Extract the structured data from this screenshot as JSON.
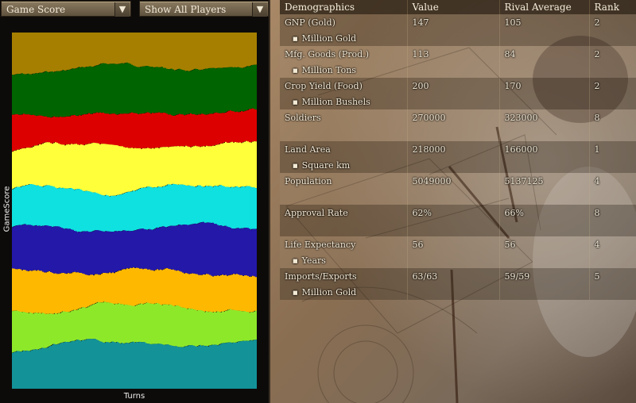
{
  "controls": {
    "score_dropdown": "Game Score",
    "players_dropdown": "Show All Players"
  },
  "graph": {
    "ylabel": "GameScore",
    "xlabel": "Turns",
    "band_colors": [
      "#a67f00",
      "#006400",
      "#dd0000",
      "#ffff3a",
      "#0fe0e0",
      "#2418a8",
      "#ffb800",
      "#8ee82a",
      "#139298"
    ]
  },
  "table": {
    "headers": [
      "Demographics",
      "Value",
      "Rival Average",
      "Rank"
    ],
    "rows": [
      {
        "name": "GNP (Gold)",
        "value": "147",
        "rival": "105",
        "rank": "2",
        "unit": "Million Gold"
      },
      {
        "name": "Mfg. Goods (Prod.)",
        "value": "113",
        "rival": "84",
        "rank": "2",
        "unit": "Million Tons"
      },
      {
        "name": "Crop Yield (Food)",
        "value": "200",
        "rival": "170",
        "rank": "2",
        "unit": "Million Bushels"
      },
      {
        "name": "Soldiers",
        "value": "270000",
        "rival": "323000",
        "rank": "8",
        "unit": ""
      },
      {
        "name": "Land Area",
        "value": "218000",
        "rival": "166000",
        "rank": "1",
        "unit": "Square km"
      },
      {
        "name": "Population",
        "value": "5049000",
        "rival": "5137125",
        "rank": "4",
        "unit": ""
      },
      {
        "name": "Approval Rate",
        "value": "62%",
        "rival": "66%",
        "rank": "8",
        "unit": ""
      },
      {
        "name": "Life Expectancy",
        "value": "56",
        "rival": "56",
        "rank": "4",
        "unit": "Years"
      },
      {
        "name": "Imports/Exports",
        "value": "63/63",
        "rival": "59/59",
        "rank": "5",
        "unit": "Million Gold"
      }
    ]
  }
}
